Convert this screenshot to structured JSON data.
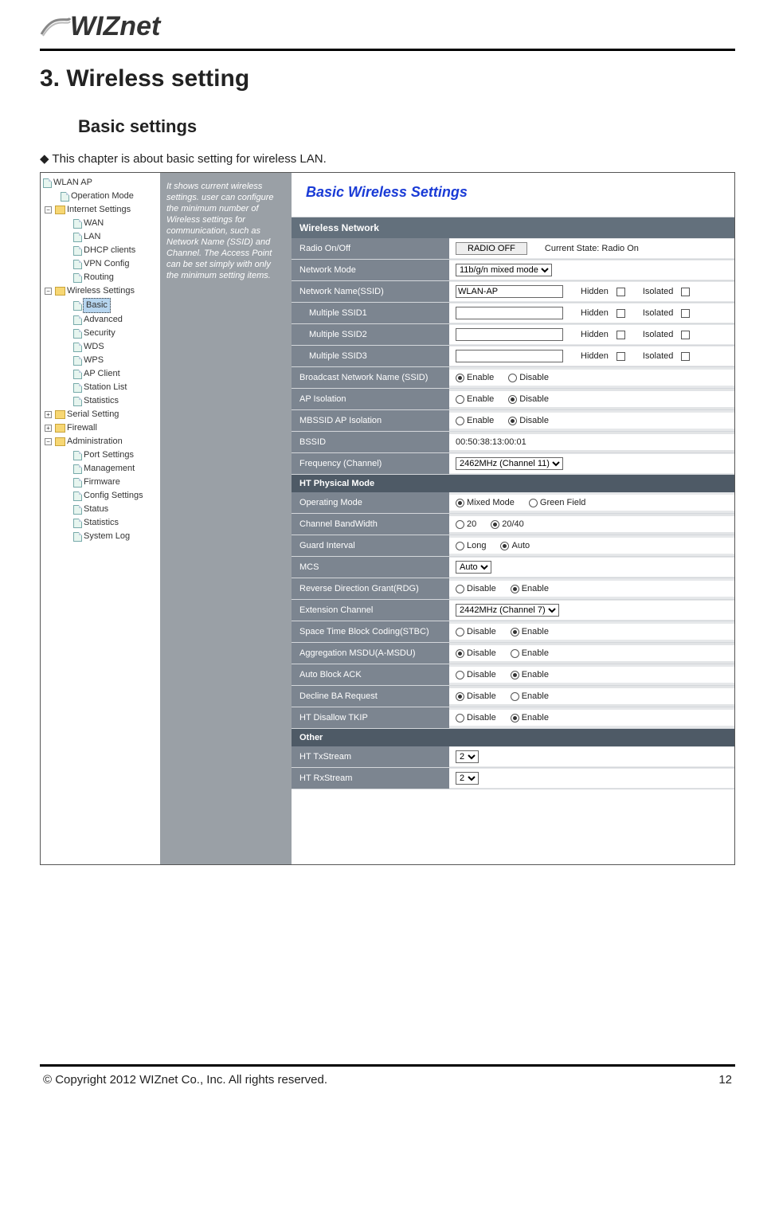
{
  "logo_text": "WIZnet",
  "doc": {
    "h1": "3. Wireless setting",
    "h2": "Basic settings",
    "intro": "◆ This chapter is about basic setting for wireless LAN."
  },
  "sidebar": {
    "root": "WLAN AP",
    "items": [
      {
        "label": "Operation Mode",
        "type": "leaf"
      },
      {
        "label": "Internet Settings",
        "type": "folder",
        "expanded": true,
        "children": [
          {
            "label": "WAN"
          },
          {
            "label": "LAN"
          },
          {
            "label": "DHCP clients"
          },
          {
            "label": "VPN Config"
          },
          {
            "label": "Routing"
          }
        ]
      },
      {
        "label": "Wireless Settings",
        "type": "folder",
        "expanded": true,
        "children": [
          {
            "label": "Basic",
            "selected": true
          },
          {
            "label": "Advanced"
          },
          {
            "label": "Security"
          },
          {
            "label": "WDS"
          },
          {
            "label": "WPS"
          },
          {
            "label": "AP Client"
          },
          {
            "label": "Station List"
          },
          {
            "label": "Statistics"
          }
        ]
      },
      {
        "label": "Serial Setting",
        "type": "folder",
        "expanded": false
      },
      {
        "label": "Firewall",
        "type": "folder",
        "expanded": false
      },
      {
        "label": "Administration",
        "type": "folder",
        "expanded": true,
        "children": [
          {
            "label": "Port Settings"
          },
          {
            "label": "Management"
          },
          {
            "label": "Firmware"
          },
          {
            "label": "Config Settings"
          },
          {
            "label": "Status"
          },
          {
            "label": "Statistics"
          },
          {
            "label": "System Log"
          }
        ]
      }
    ]
  },
  "help_text": "It shows current wireless settings. user can configure the minimum number of Wireless settings for communication, such as Network Name (SSID) and Channel. The Access Point can be set simply with only the minimum setting items.",
  "panel": {
    "title": "Basic Wireless Settings",
    "section1": "Wireless Network",
    "radio_label": "Radio On/Off",
    "radio_btn": "RADIO OFF",
    "radio_state": "Current State: Radio On",
    "netmode_label": "Network Mode",
    "netmode_value": "11b/g/n mixed mode",
    "ssid_label": "Network Name(SSID)",
    "ssid_value": "WLAN-AP",
    "hidden": "Hidden",
    "isolated": "Isolated",
    "mssid1": "Multiple SSID1",
    "mssid2": "Multiple SSID2",
    "mssid3": "Multiple SSID3",
    "bcast_label": "Broadcast Network Name (SSID)",
    "enable": "Enable",
    "disable": "Disable",
    "apiso_label": "AP Isolation",
    "mbssid_label": "MBSSID AP Isolation",
    "bssid_label": "BSSID",
    "bssid_value": "00:50:38:13:00:01",
    "freq_label": "Frequency (Channel)",
    "freq_value": "2462MHz (Channel 11)",
    "section2": "HT Physical Mode",
    "opmode_label": "Operating Mode",
    "opmode_a": "Mixed Mode",
    "opmode_b": "Green Field",
    "cbw_label": "Channel BandWidth",
    "cbw_a": "20",
    "cbw_b": "20/40",
    "gi_label": "Guard Interval",
    "gi_a": "Long",
    "gi_b": "Auto",
    "mcs_label": "MCS",
    "mcs_value": "Auto",
    "rdg_label": "Reverse Direction Grant(RDG)",
    "ext_label": "Extension Channel",
    "ext_value": "2442MHz (Channel 7)",
    "stbc_label": "Space Time Block Coding(STBC)",
    "amsdu_label": "Aggregation MSDU(A-MSDU)",
    "aback_label": "Auto Block ACK",
    "dba_label": "Decline BA Request",
    "tkip_label": "HT Disallow TKIP",
    "section3": "Other",
    "txs_label": "HT TxStream",
    "txs_value": "2",
    "rxs_label": "HT RxStream",
    "rxs_value": "2"
  },
  "footer": {
    "copy": "© Copyright 2012 WIZnet Co., Inc. All rights reserved.",
    "page": "12"
  }
}
